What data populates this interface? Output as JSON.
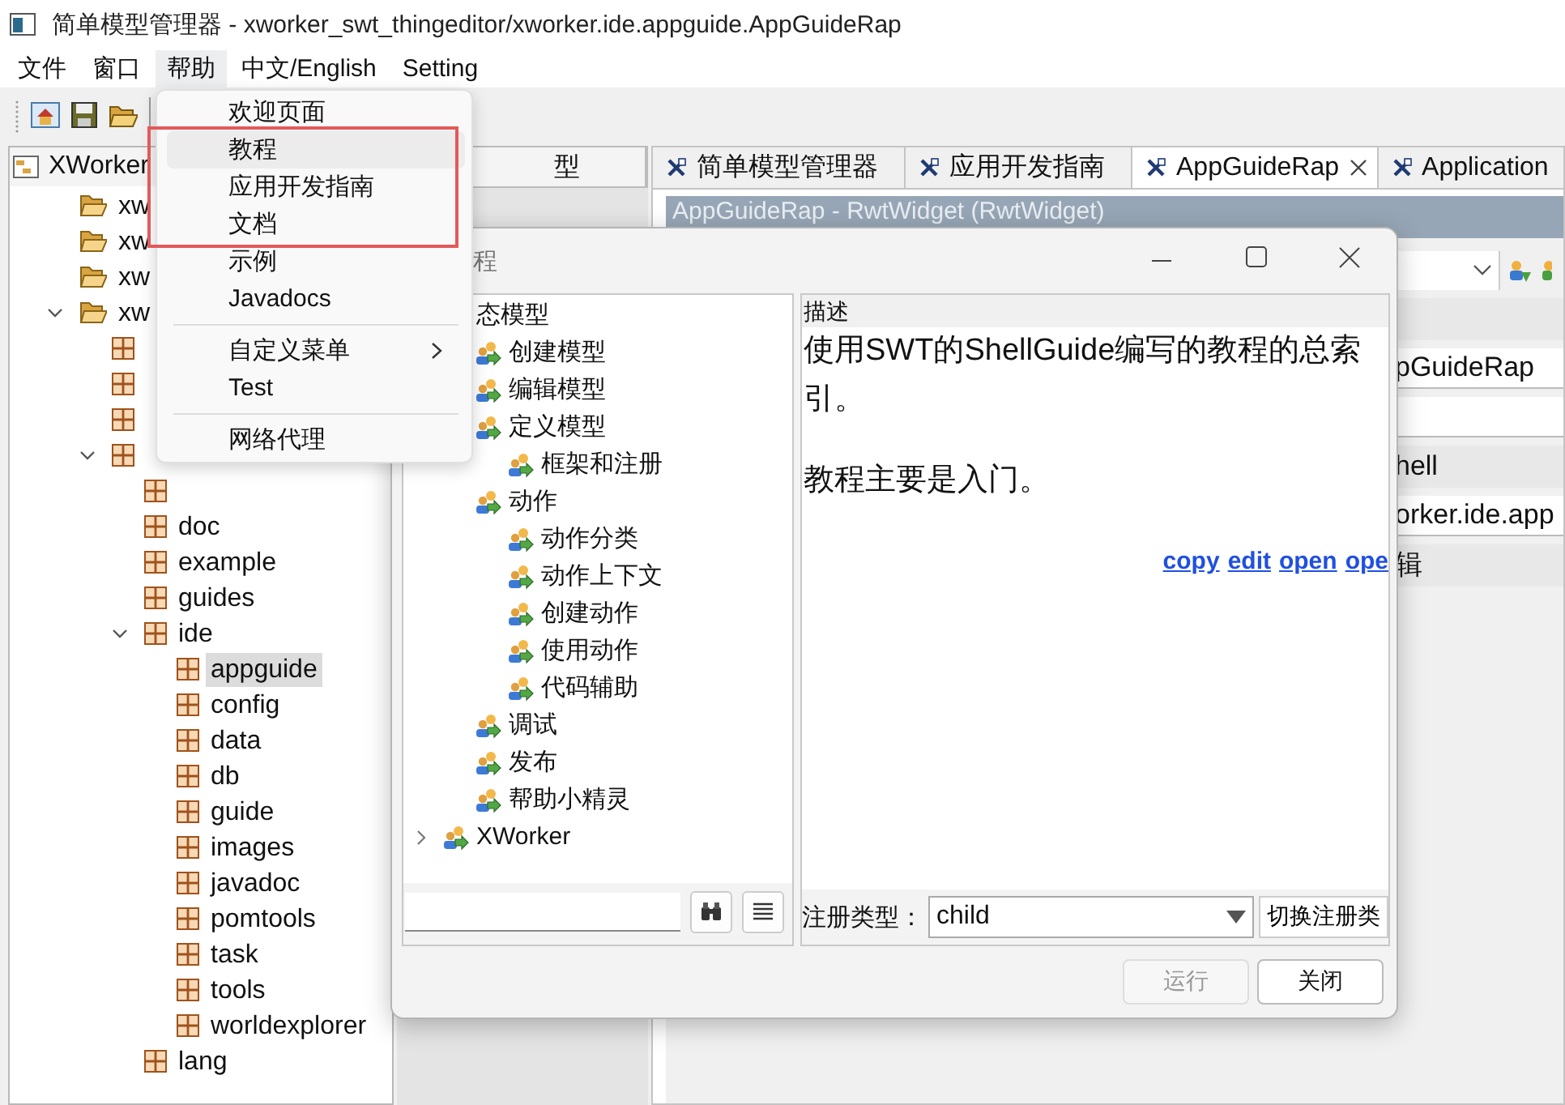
{
  "window": {
    "title": "简单模型管理器 - xworker_swt_thingeditor/xworker.ide.appguide.AppGuideRap"
  },
  "menubar": [
    {
      "label": "文件",
      "selected": false
    },
    {
      "label": "窗口",
      "selected": false
    },
    {
      "label": "帮助",
      "selected": true
    },
    {
      "label": "中文/English",
      "selected": false
    },
    {
      "label": "Setting",
      "selected": false
    }
  ],
  "help_menu": [
    {
      "kind": "item",
      "label": "欢迎页面",
      "selected": false
    },
    {
      "kind": "item",
      "label": "教程",
      "selected": true
    },
    {
      "kind": "item",
      "label": "应用开发指南",
      "selected": false
    },
    {
      "kind": "item",
      "label": "文档",
      "selected": false
    },
    {
      "kind": "item",
      "label": "示例",
      "selected": false
    },
    {
      "kind": "item",
      "label": "Javadocs",
      "selected": false
    },
    {
      "kind": "separator"
    },
    {
      "kind": "submenu",
      "label": "自定义菜单",
      "selected": false
    },
    {
      "kind": "item",
      "label": "Test",
      "selected": false
    },
    {
      "kind": "separator"
    },
    {
      "kind": "item",
      "label": "网络代理",
      "selected": false
    }
  ],
  "left_panel": {
    "title": "XWorker",
    "tree": [
      {
        "kind": "folder",
        "label": "xw",
        "selected": false
      },
      {
        "kind": "folder",
        "label": "xw",
        "selected": false
      },
      {
        "kind": "folder",
        "label": "xw",
        "selected": false
      },
      {
        "kind": "folder",
        "label": "xw",
        "selected": false,
        "expanded": true,
        "children": [
          {
            "kind": "package"
          },
          {
            "kind": "package"
          },
          {
            "kind": "package"
          },
          {
            "kind": "package",
            "expanded": true,
            "children": [
              {
                "kind": "package"
              },
              {
                "kind": "package",
                "label": "doc",
                "selected": false
              },
              {
                "kind": "package",
                "label": "example",
                "selected": false
              },
              {
                "kind": "package",
                "label": "guides",
                "selected": false
              },
              {
                "kind": "package",
                "label": "ide",
                "selected": false,
                "expanded": true,
                "children": [
                  {
                    "kind": "package",
                    "label": "appguide",
                    "selected": true
                  },
                  {
                    "kind": "package",
                    "label": "config",
                    "selected": false
                  },
                  {
                    "kind": "package",
                    "label": "data",
                    "selected": false
                  },
                  {
                    "kind": "package",
                    "label": "db",
                    "selected": false
                  },
                  {
                    "kind": "package",
                    "label": "guide",
                    "selected": false
                  },
                  {
                    "kind": "package",
                    "label": "images",
                    "selected": false
                  },
                  {
                    "kind": "package",
                    "label": "javadoc",
                    "selected": false
                  },
                  {
                    "kind": "package",
                    "label": "pomtools",
                    "selected": false
                  },
                  {
                    "kind": "package",
                    "label": "task",
                    "selected": false
                  },
                  {
                    "kind": "package",
                    "label": "tools",
                    "selected": false
                  },
                  {
                    "kind": "package",
                    "label": "worldexplorer",
                    "selected": false
                  }
                ]
              },
              {
                "kind": "package",
                "label": "lang",
                "selected": false
              }
            ]
          }
        ]
      }
    ]
  },
  "middle_panel": {
    "tab": "型"
  },
  "editor": {
    "tabs": [
      {
        "label": "简单模型管理器",
        "selected": false
      },
      {
        "label": "应用开发指南",
        "selected": false
      },
      {
        "label": "AppGuideRap",
        "selected": true
      },
      {
        "label": "Application",
        "selected": false
      }
    ],
    "header": "AppGuideRap - RwtWidget  (RwtWidget)",
    "form": [
      {
        "kind": "combo"
      },
      {
        "kind": "label"
      },
      {
        "kind": "field",
        "value": "pGuideRap"
      },
      {
        "kind": "field"
      },
      {
        "kind": "label",
        "text": "hell"
      },
      {
        "kind": "field",
        "value": "orker.ide.app"
      },
      {
        "kind": "label",
        "text": "辑"
      }
    ]
  },
  "dialog": {
    "title": "程",
    "tree": [
      {
        "kind": "text",
        "label": "态模型",
        "children": [
          {
            "kind": "node",
            "label": "创建模型"
          },
          {
            "kind": "node",
            "label": "编辑模型"
          },
          {
            "kind": "node",
            "label": "定义模型",
            "children": [
              {
                "kind": "node",
                "label": "框架和注册"
              }
            ]
          },
          {
            "kind": "node",
            "label": "动作",
            "children": [
              {
                "kind": "node",
                "label": "动作分类"
              },
              {
                "kind": "node",
                "label": "动作上下文"
              },
              {
                "kind": "node",
                "label": "创建动作"
              },
              {
                "kind": "node",
                "label": "使用动作"
              },
              {
                "kind": "node",
                "label": "代码辅助"
              }
            ]
          },
          {
            "kind": "node",
            "label": "调试"
          },
          {
            "kind": "node",
            "label": "发布"
          },
          {
            "kind": "node",
            "label": "帮助小精灵"
          }
        ]
      },
      {
        "kind": "node",
        "label": "XWorker",
        "expanded": false
      }
    ],
    "description_header": "描述",
    "description": [
      "使用SWT的ShellGuide编写的教程的总索引。",
      "教程主要是入门。"
    ],
    "links": [
      "copy",
      "edit",
      "open",
      "ope"
    ],
    "register_label": "注册类型：",
    "register_type": "child",
    "switch_button": "切换注册类",
    "buttons": [
      {
        "label": "运行",
        "disabled": true
      },
      {
        "label": "关闭",
        "disabled": false
      }
    ]
  }
}
